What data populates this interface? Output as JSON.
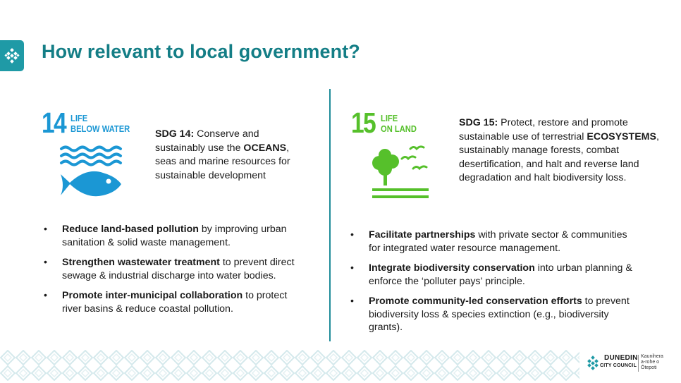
{
  "header": {
    "title": "How relevant to local government?"
  },
  "left": {
    "sdg_number": "14",
    "sdg_name": "LIFE\nBELOW WATER",
    "sdg_color": "#1b97d4",
    "icon": "fish-waves-icon",
    "desc_label": "SDG 14:",
    "desc_part1": "Conserve and sustainably use the",
    "desc_keyword": "OCEANS",
    "desc_part2": ", seas and marine resources for sustainable development",
    "bullets": [
      {
        "bold": "Reduce land-based pollution",
        "text": " by improving urban sanitation & solid waste management."
      },
      {
        "bold": "Strengthen wastewater treatment",
        "text": " to prevent direct sewage & industrial discharge into water bodies."
      },
      {
        "bold": "Promote inter-municipal collaboration",
        "text": " to protect river basins & reduce coastal pollution."
      }
    ]
  },
  "right": {
    "sdg_number": "15",
    "sdg_name": "LIFE\nON LAND",
    "sdg_color": "#56c02b",
    "icon": "tree-birds-icon",
    "desc_label": "SDG 15:",
    "desc_part1": "Protect, restore and promote sustainable use of terrestrial",
    "desc_keyword": "ECOSYSTEMS",
    "desc_part2": ", sustainably manage forests, combat desertification, and halt and reverse land degradation and halt biodiversity loss.",
    "bullets": [
      {
        "bold": "Facilitate partnerships",
        "text": " with private sector & communities for integrated water resource management."
      },
      {
        "bold": "Integrate biodiversity conservation",
        "text": " into urban planning & enforce the ‘polluter pays’ principle."
      },
      {
        "bold": "Promote community-led conservation efforts",
        "text": " to prevent biodiversity loss & species extinction (e.g., biodiversity grants)."
      }
    ]
  },
  "footer": {
    "org_name": "DUNEDIN",
    "org_sub": "CITY COUNCIL",
    "org_maori": "Kaunihera\na-rohe o\nŌtepoti",
    "icon": "dcc-logo-icon"
  },
  "bullet_char": "•"
}
